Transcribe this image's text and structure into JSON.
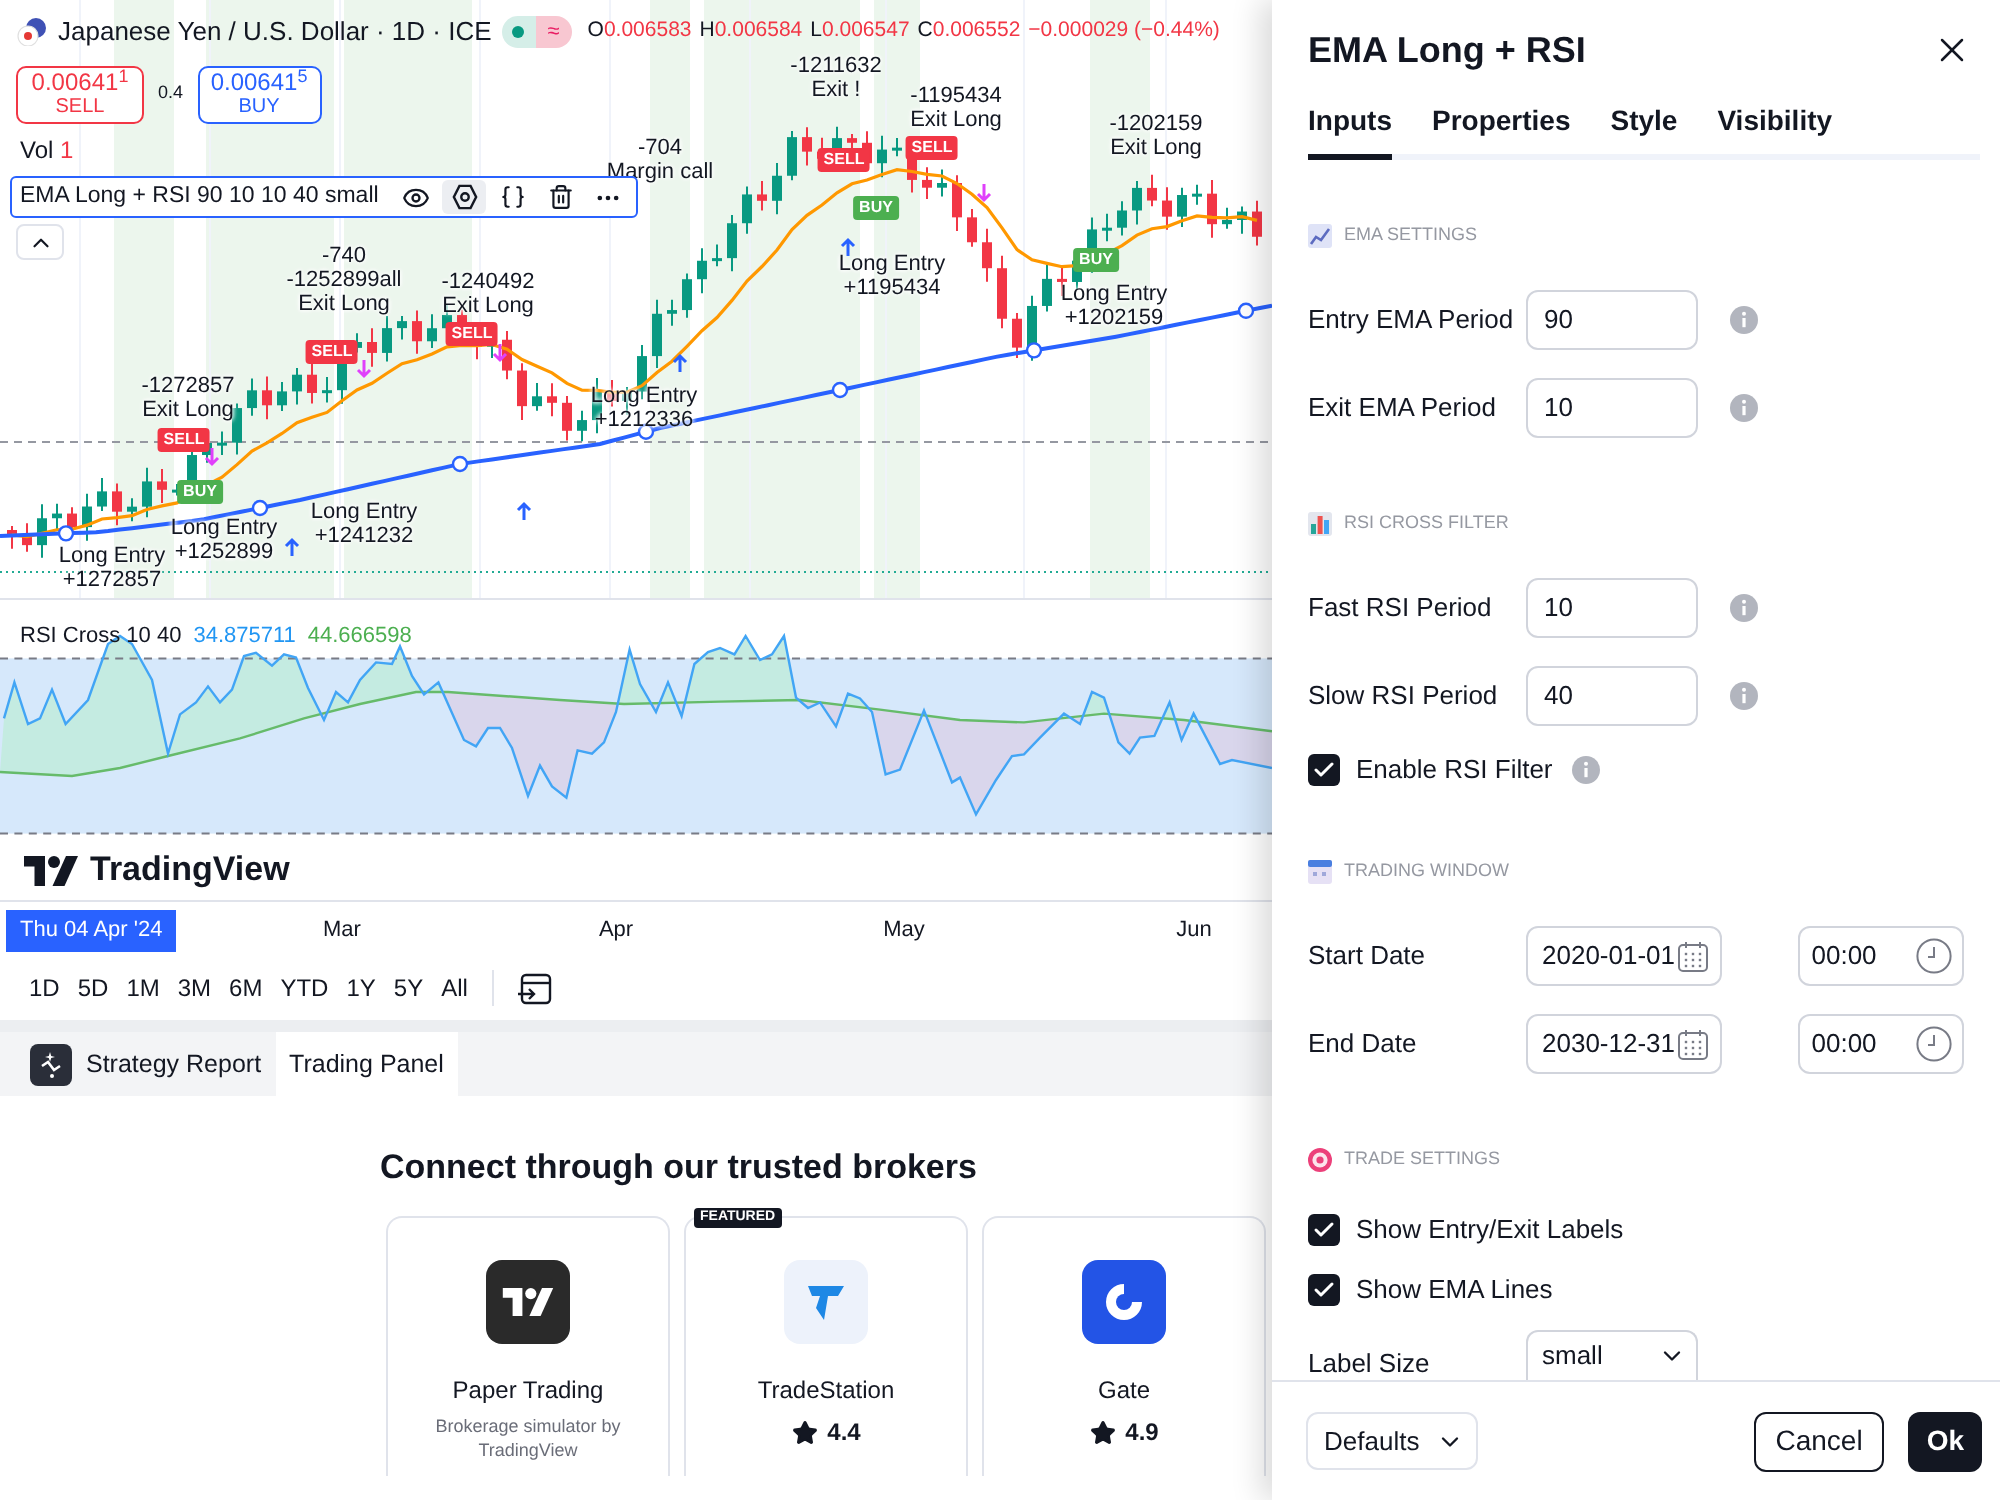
{
  "header": {
    "title": "Japanese Yen / U.S. Dollar · 1D · ICE",
    "status_glyph": "≈",
    "ohlc": [
      {
        "label": "O",
        "value": "0.006583"
      },
      {
        "label": "H",
        "value": "0.006584"
      },
      {
        "label": "L",
        "value": "0.006547"
      },
      {
        "label": "C",
        "value": "0.006552"
      }
    ],
    "change": "−0.000029 (−0.44%)"
  },
  "quote": {
    "sell": {
      "price": "0.00641$^{1}$",
      "label": "SELL"
    },
    "spread": "0.4",
    "buy": {
      "price": "0.00641$^{5}$",
      "label": "BUY"
    }
  },
  "volume": {
    "label": "Vol",
    "value": "1"
  },
  "indicator_legend": "EMA Long + RSI 90 10 10 40 small",
  "main_chart": {
    "trade_labels": [
      {
        "lines": [
          "-704",
          "Margin call"
        ]
      },
      {
        "lines": [
          "-1211632",
          "Exit !"
        ]
      },
      {
        "lines": [
          "-1195434",
          "Exit Long"
        ]
      },
      {
        "lines": [
          "-1202159",
          "Exit Long"
        ]
      },
      {
        "lines": [
          "-740",
          "-1252899all",
          "Exit Long"
        ]
      },
      {
        "lines": [
          "-1240492",
          "Exit Long"
        ]
      },
      {
        "lines": [
          "-1272857",
          "Exit Long"
        ]
      },
      {
        "lines": [
          "Long Entry",
          "+1241232"
        ]
      },
      {
        "lines": [
          "Long Entry",
          "+1212336"
        ]
      },
      {
        "lines": [
          "Long Entry",
          "+1195434"
        ]
      },
      {
        "lines": [
          "Long Entry",
          "+1202159"
        ]
      },
      {
        "lines": [
          "Long Entry",
          "+1272857"
        ]
      },
      {
        "lines": [
          "Long Entry",
          "+1252899"
        ]
      }
    ],
    "markers": [
      {
        "kind": "sell",
        "text": "SELL"
      },
      {
        "kind": "sell",
        "text": "SELL"
      },
      {
        "kind": "sell",
        "text": "SELL"
      },
      {
        "kind": "sell",
        "text": "SELL"
      },
      {
        "kind": "sell",
        "text": "SELL"
      },
      {
        "kind": "buy",
        "text": "BUY"
      },
      {
        "kind": "buy",
        "text": "BUY"
      },
      {
        "kind": "buy",
        "text": "BUY"
      }
    ]
  },
  "rsi_pane": {
    "title": "RSI Cross 10 40",
    "values": [
      {
        "kind": "fast",
        "value": "34.875711"
      },
      {
        "kind": "slow",
        "value": "44.666598"
      }
    ]
  },
  "logo": "TradingView",
  "time_axis": {
    "cursor_label": "Thu 04 Apr '24",
    "months": [
      "Mar",
      "Apr",
      "May",
      "Jun"
    ]
  },
  "ranges": [
    "1D",
    "5D",
    "1M",
    "3M",
    "6M",
    "YTD",
    "1Y",
    "5Y",
    "All"
  ],
  "bottom_panel": {
    "tabs": [
      {
        "label": "Strategy Report",
        "selected": false
      },
      {
        "label": "Trading Panel",
        "selected": true
      }
    ],
    "heading": "Connect through our trusted brokers",
    "brokers": [
      {
        "kind": "paper",
        "name": "Paper Trading",
        "description": "Brokerage simulator by TradingView"
      },
      {
        "kind": "tradestation",
        "name": "TradeStation",
        "tag": "FEATURED",
        "rating": "4.4"
      },
      {
        "kind": "gate",
        "name": "Gate",
        "rating": "4.9"
      }
    ]
  },
  "dialog": {
    "title": "EMA Long + RSI",
    "tabs": [
      {
        "label": "Inputs",
        "selected": true
      },
      {
        "label": "Properties",
        "selected": false
      },
      {
        "label": "Style",
        "selected": false
      },
      {
        "label": "Visibility",
        "selected": false
      }
    ],
    "sections": [
      {
        "kind": "ema",
        "title": "EMA SETTINGS",
        "rows": [
          {
            "kind": "number",
            "label": "Entry EMA Period",
            "value": "90",
            "info": true
          },
          {
            "kind": "number",
            "label": "Exit EMA Period",
            "value": "10",
            "info": true
          }
        ]
      },
      {
        "kind": "rsi",
        "title": "RSI CROSS FILTER",
        "rows": [
          {
            "kind": "number",
            "label": "Fast RSI Period",
            "value": "10",
            "info": true
          },
          {
            "kind": "number",
            "label": "Slow RSI Period",
            "value": "40",
            "info": true
          },
          {
            "kind": "checkbox",
            "label": "Enable RSI Filter",
            "checked": true,
            "info": true
          }
        ]
      },
      {
        "kind": "window",
        "title": "TRADING WINDOW",
        "rows": [
          {
            "kind": "datetime",
            "label": "Start Date",
            "date": "2020-01-01",
            "time": "00:00"
          },
          {
            "kind": "datetime",
            "label": "End Date",
            "date": "2030-12-31",
            "time": "00:00"
          }
        ]
      },
      {
        "kind": "trade",
        "title": "TRADE SETTINGS",
        "rows": [
          {
            "kind": "checkbox",
            "label": "Show Entry/Exit Labels",
            "checked": true,
            "info": false
          },
          {
            "kind": "checkbox",
            "label": "Show EMA Lines",
            "checked": true,
            "info": false
          },
          {
            "kind": "select",
            "label": "Label Size",
            "value": "small"
          }
        ]
      }
    ],
    "footer": {
      "defaults": "Defaults",
      "cancel": "Cancel",
      "ok": "Ok"
    }
  }
}
